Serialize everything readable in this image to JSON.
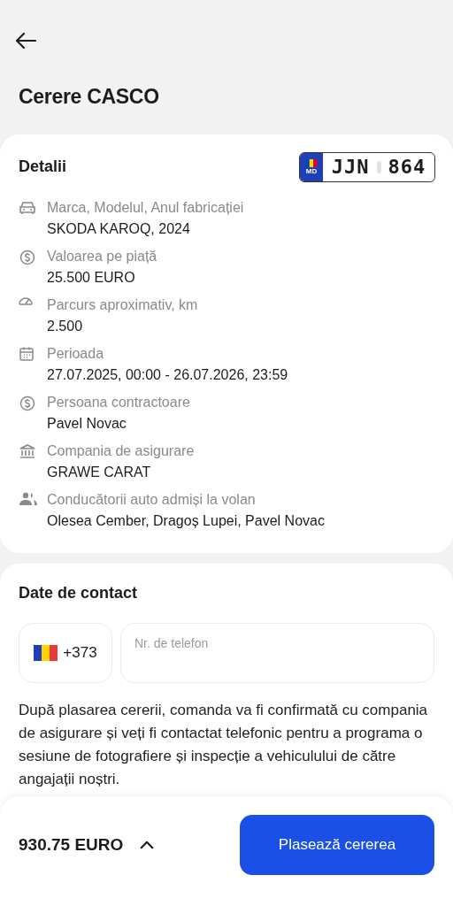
{
  "title": "Cerere CASCO",
  "details": {
    "heading": "Detalii",
    "plate": {
      "country": "MD",
      "letters": "JJN",
      "digits": "864"
    },
    "items": [
      {
        "label": "Marca, Modelul, Anul fabricației",
        "value": "SKODA KAROQ, 2024"
      },
      {
        "label": "Valoarea pe piață",
        "value": "25.500 EURO"
      },
      {
        "label": "Parcurs aproximativ, km",
        "value": "2.500"
      },
      {
        "label": "Perioada",
        "value": "27.07.2025, 00:00 - 26.07.2026, 23:59"
      },
      {
        "label": "Persoana contractoare",
        "value": "Pavel Novac"
      },
      {
        "label": "Compania de asigurare",
        "value": "GRAWE CARAT"
      },
      {
        "label": "Conducătorii auto admiși la volan",
        "value": "Olesea Cember, Dragoș Lupei, Pavel Novac"
      }
    ]
  },
  "contact": {
    "heading": "Date de contact",
    "country_code": "+373",
    "phone_placeholder": "Nr. de telefon",
    "note": "După plasarea cererii, comanda va fi confirmată cu compania de asigurare și veți fi contactat telefonic pentru a programa o sesiune de fotografiere și inspecție a vehiculului de către angajații noștri."
  },
  "footer": {
    "total": "930.75 EURO",
    "expanded": false,
    "button": "Plasează cererea"
  }
}
